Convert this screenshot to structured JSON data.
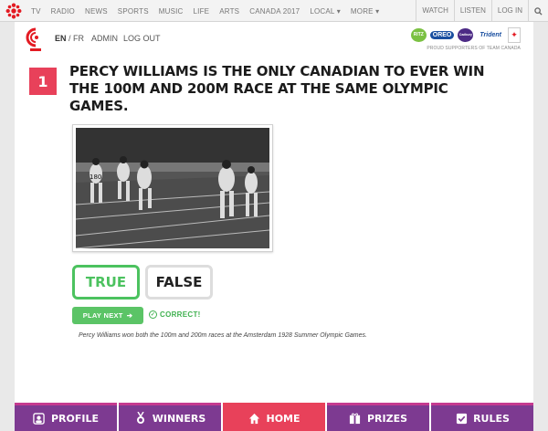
{
  "topnav": {
    "links": [
      {
        "label": "TV",
        "dropdown": false
      },
      {
        "label": "RADIO",
        "dropdown": false
      },
      {
        "label": "NEWS",
        "dropdown": false
      },
      {
        "label": "SPORTS",
        "dropdown": false
      },
      {
        "label": "MUSIC",
        "dropdown": false
      },
      {
        "label": "LIFE",
        "dropdown": false
      },
      {
        "label": "ARTS",
        "dropdown": false
      },
      {
        "label": "CANADA 2017",
        "dropdown": false
      },
      {
        "label": "LOCAL",
        "dropdown": true
      },
      {
        "label": "MORE",
        "dropdown": true
      }
    ],
    "watch": "WATCH",
    "listen": "LISTEN",
    "login": "LOG IN",
    "search_icon": "search-icon"
  },
  "subhead": {
    "lang_en": "EN",
    "lang_sep": " / ",
    "lang_fr": "FR",
    "admin": "ADMIN",
    "logout": "LOG OUT",
    "sponsors": {
      "ritz": "RITZ",
      "oreo": "OREO",
      "cadbury": "Cadbury",
      "trident": "Trident",
      "caption": "PROUD SUPPORTERS OF TEAM CANADA"
    }
  },
  "question": {
    "number": "1",
    "text": "Percy Williams is the only Canadian to ever win the 100m and 200m race at the same Olympic Games."
  },
  "answers": {
    "true_label": "TRUE",
    "false_label": "FALSE"
  },
  "result": {
    "play_next": "PLAY NEXT",
    "play_next_arrow": "➔",
    "status": "CORRECT!",
    "explanation": "Percy Williams won both the 100m and 200m races at the Amsterdam 1928 Summer Olympic Games."
  },
  "bottom_nav": [
    {
      "label": "PROFILE",
      "icon": "profile-icon",
      "active": false
    },
    {
      "label": "WINNERS",
      "icon": "medal-icon",
      "active": false
    },
    {
      "label": "HOME",
      "icon": "home-icon",
      "active": true
    },
    {
      "label": "PRIZES",
      "icon": "gift-icon",
      "active": false
    },
    {
      "label": "RULES",
      "icon": "rules-icon",
      "active": false
    }
  ],
  "colors": {
    "brand_red": "#e8415a",
    "accent_green": "#4cc25f",
    "nav_purple": "#7d3a91"
  }
}
